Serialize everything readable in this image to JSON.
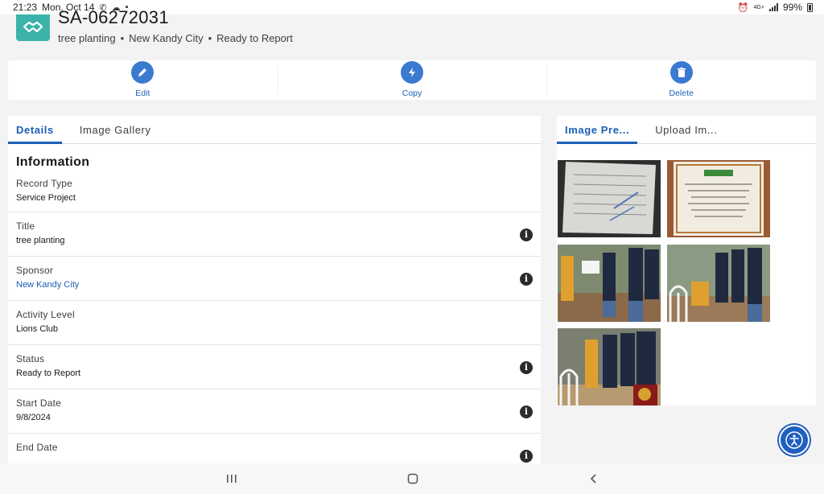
{
  "status_bar": {
    "time": "21:23",
    "date": "Mon, Oct 14",
    "network": "4G+",
    "battery": "99%"
  },
  "header": {
    "record_name": "SA-06272031",
    "subtitle": [
      "tree planting",
      "New Kandy City",
      "Ready to Report"
    ],
    "separator": "•"
  },
  "actions": [
    {
      "label": "Edit",
      "icon": "pencil-icon"
    },
    {
      "label": "Copy",
      "icon": "lightning-icon"
    },
    {
      "label": "Delete",
      "icon": "trash-icon"
    }
  ],
  "left_tabs": [
    "Details",
    "Image Gallery"
  ],
  "details": {
    "section_title": "Information",
    "fields": [
      {
        "label": "Record Type",
        "value": "Service Project"
      },
      {
        "label": "Title",
        "value": "tree planting"
      },
      {
        "label": "Sponsor",
        "value": "New Kandy City"
      },
      {
        "label": "Activity Level",
        "value": "Lions Club"
      },
      {
        "label": "Status",
        "value": "Ready to Report"
      },
      {
        "label": "Start Date",
        "value": "9/8/2024"
      },
      {
        "label": "End Date",
        "value": ""
      }
    ]
  },
  "right_tabs": [
    "Image Pre...",
    "Upload Im..."
  ],
  "colors": {
    "brand_blue": "#1b5fb5",
    "action_blue": "#3b7ad1",
    "record_teal": "#3bb3a8"
  }
}
